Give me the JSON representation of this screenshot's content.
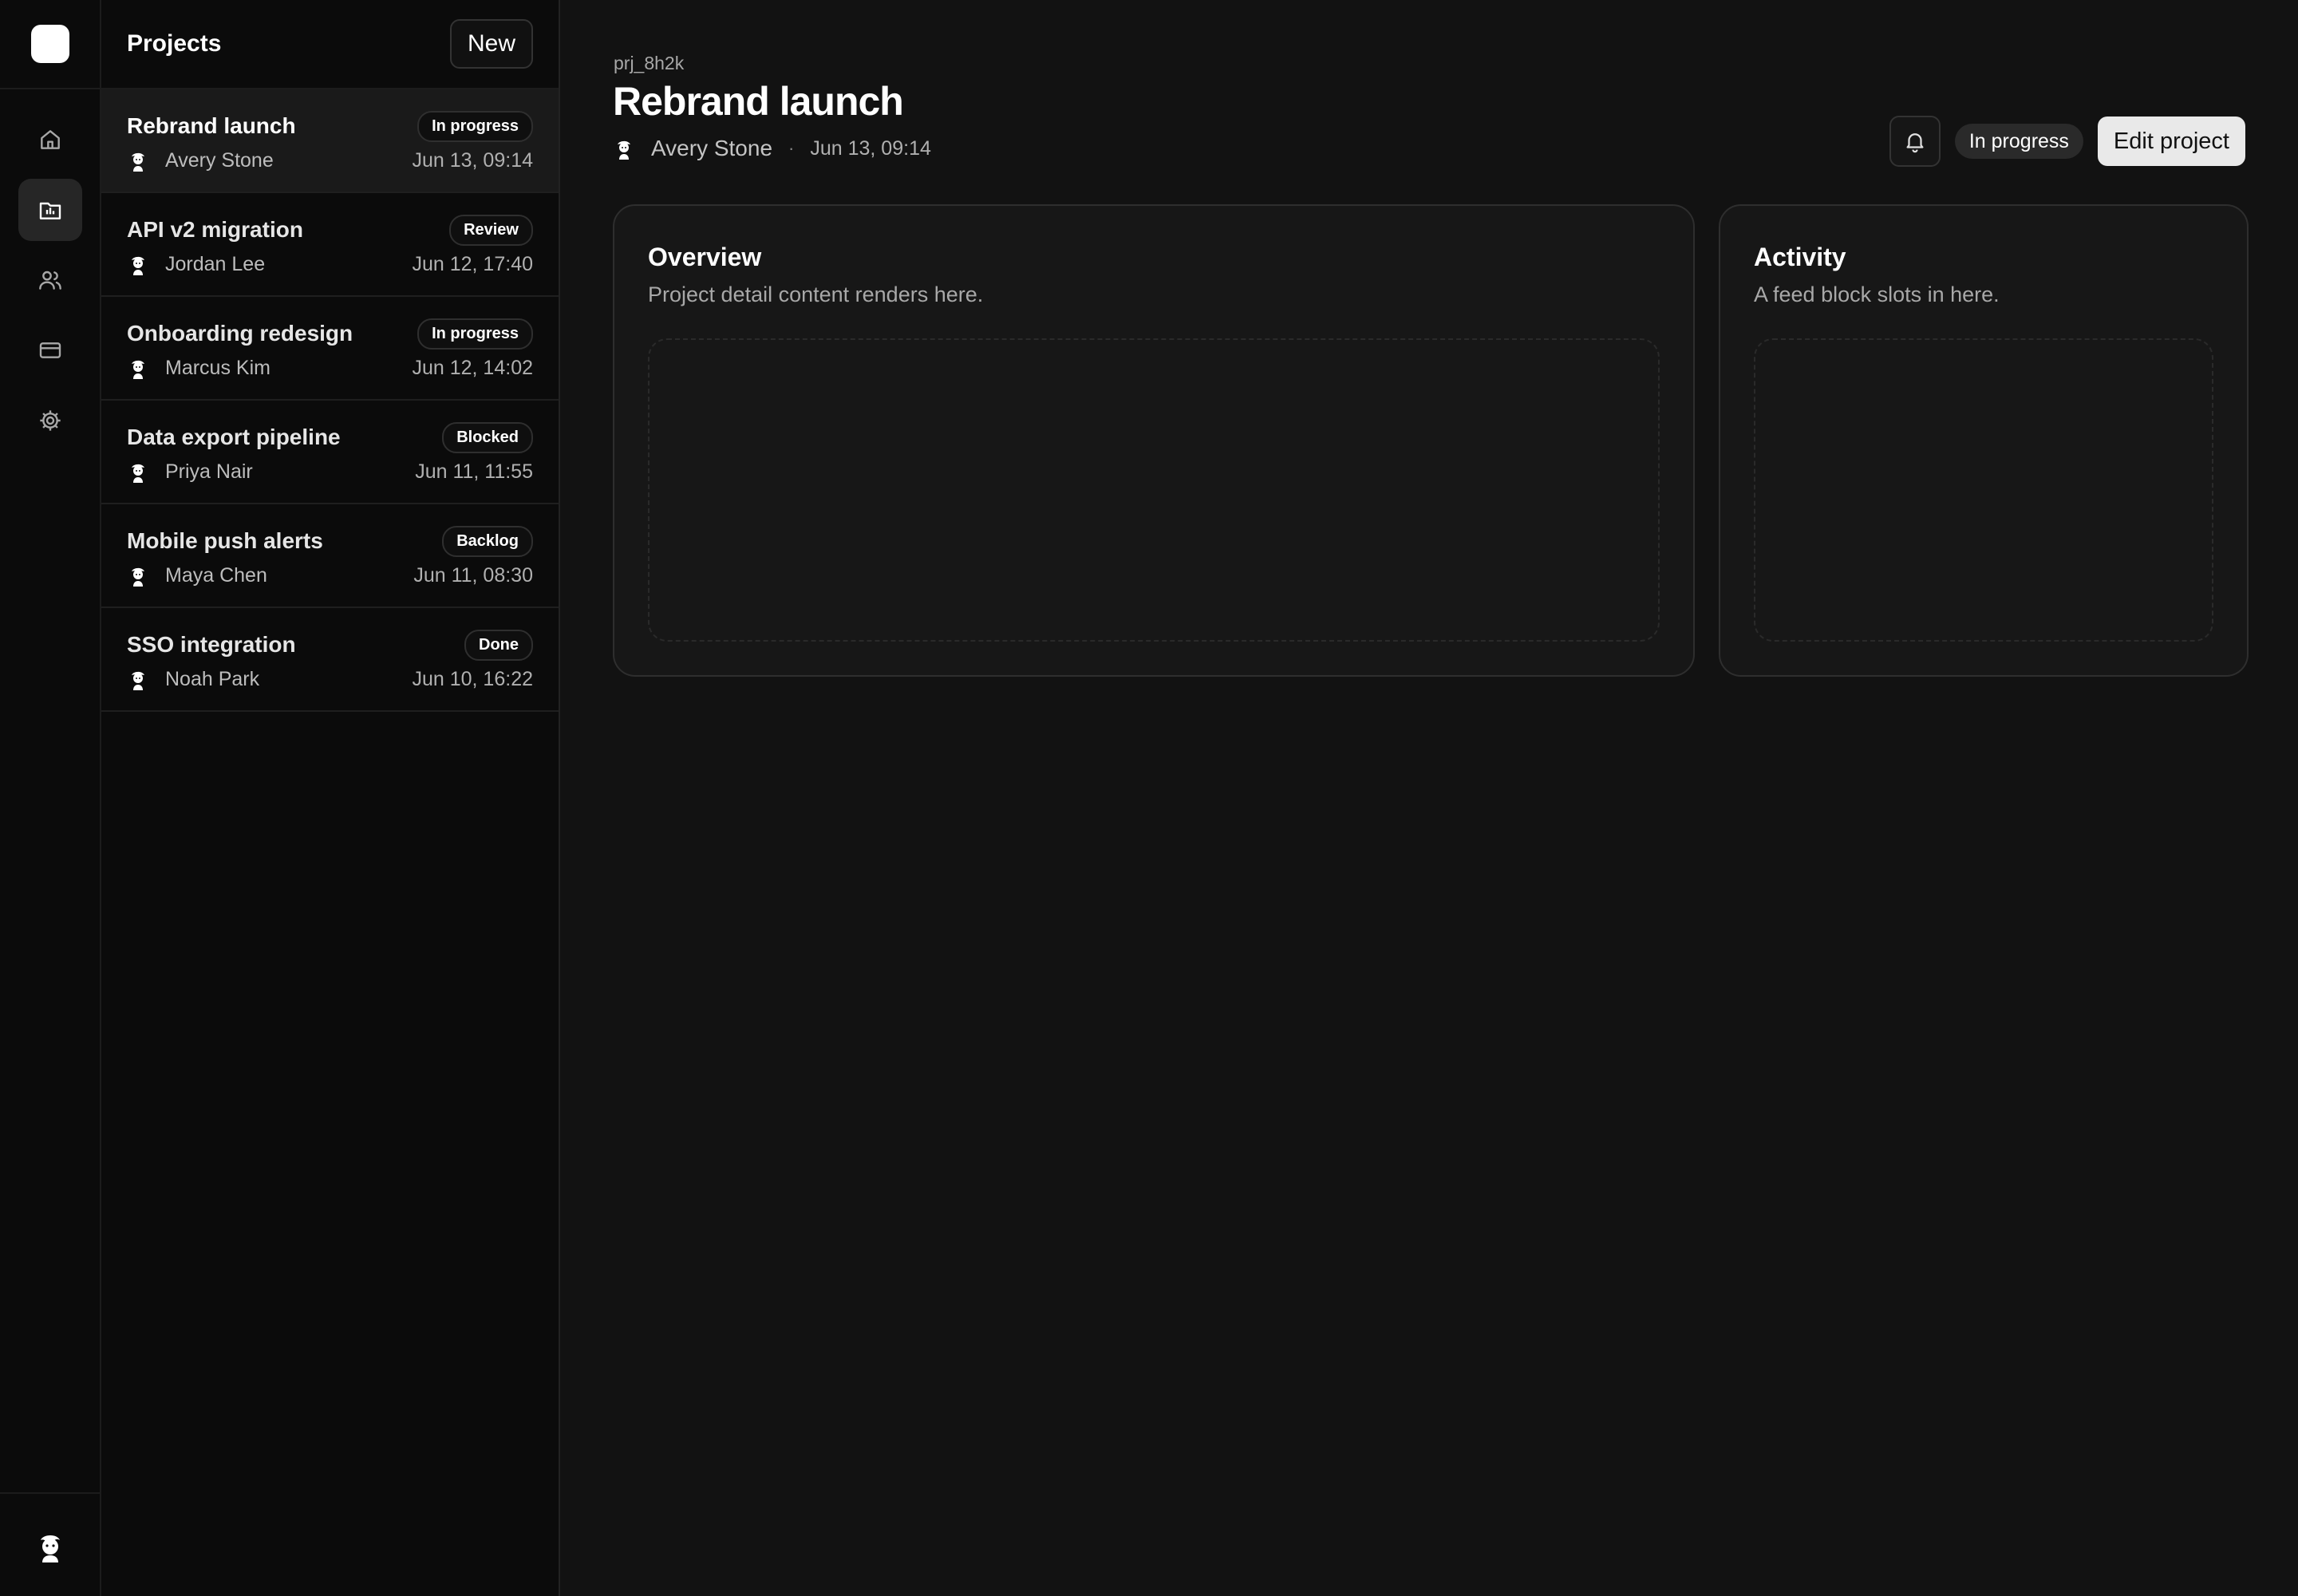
{
  "rail": {
    "icons": [
      "home-icon",
      "projects-icon",
      "users-icon",
      "billing-icon",
      "settings-icon"
    ],
    "active": "projects-icon"
  },
  "list": {
    "title": "Projects",
    "new_label": "New",
    "projects": [
      {
        "name": "Rebrand launch",
        "status": "In progress",
        "owner": "Avery Stone",
        "date": "Jun 13, 09:14",
        "selected": true
      },
      {
        "name": "API v2 migration",
        "status": "Review",
        "owner": "Jordan Lee",
        "date": "Jun 12, 17:40"
      },
      {
        "name": "Onboarding redesign",
        "status": "In progress",
        "owner": "Marcus Kim",
        "date": "Jun 12, 14:02"
      },
      {
        "name": "Data export pipeline",
        "status": "Blocked",
        "owner": "Priya Nair",
        "date": "Jun 11, 11:55"
      },
      {
        "name": "Mobile push alerts",
        "status": "Backlog",
        "owner": "Maya Chen",
        "date": "Jun 11, 08:30"
      },
      {
        "name": "SSO integration",
        "status": "Done",
        "owner": "Noah Park",
        "date": "Jun 10, 16:22"
      }
    ]
  },
  "detail": {
    "id": "prj_8h2k",
    "title": "Rebrand launch",
    "owner": "Avery Stone",
    "separator": "·",
    "date": "Jun 13, 09:14",
    "status": "In progress",
    "edit_label": "Edit project",
    "overview": {
      "title": "Overview",
      "subtitle": "Project detail content renders here."
    },
    "activity": {
      "title": "Activity",
      "subtitle": "A feed block slots in here."
    }
  }
}
